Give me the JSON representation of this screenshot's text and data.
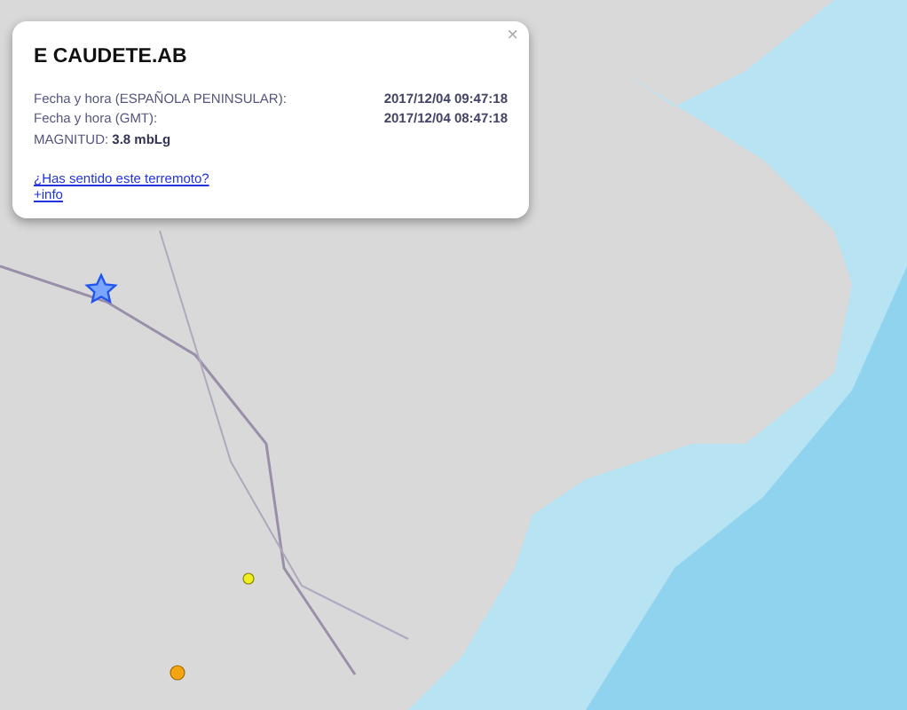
{
  "popup": {
    "close": "×",
    "title": "E CAUDETE.AB",
    "rows": [
      {
        "label": "Fecha y hora (ESPAÑOLA PENINSULAR):",
        "value": "2017/12/04 09:47:18"
      },
      {
        "label": "Fecha y hora (GMT):",
        "value": "2017/12/04 08:47:18"
      }
    ],
    "magnitude": "MAGNITUD: **3.8 mbLg**",
    "links": [
      "¿Has sentido este terremoto?",
      "+info"
    ]
  }
}
